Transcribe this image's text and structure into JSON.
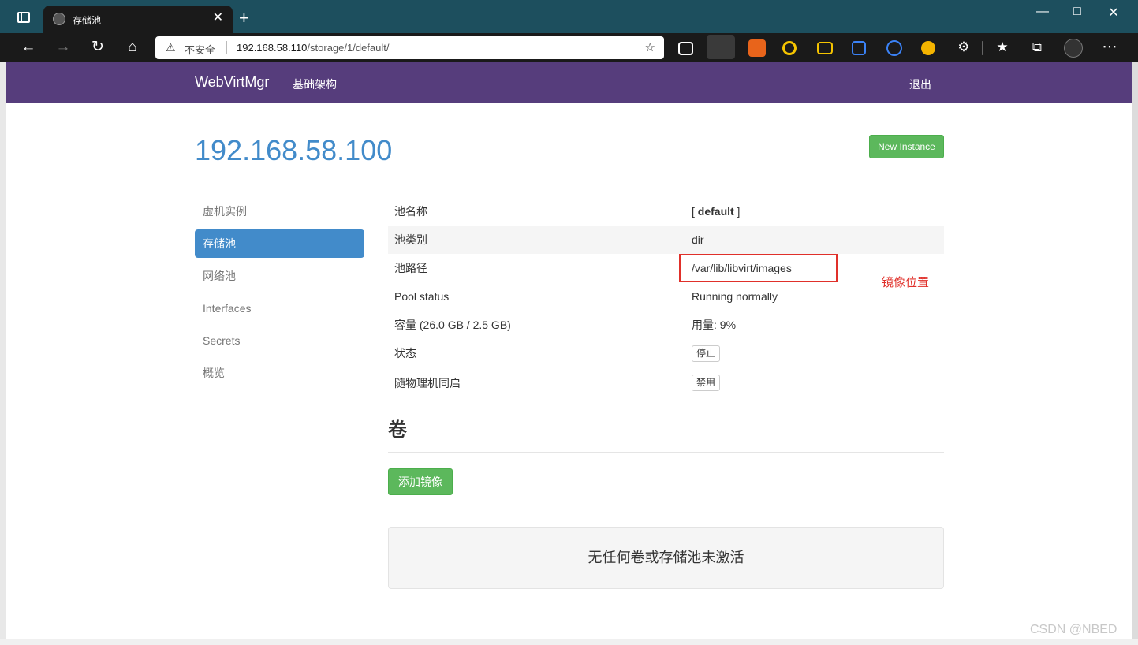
{
  "browser": {
    "tab_title": "存储池",
    "tab_close": "✕",
    "new_tab": "+",
    "insecure_label": "不安全",
    "url_host": "192.168.58.110",
    "url_path": "/storage/1/default/"
  },
  "navbar": {
    "brand": "WebVirtMgr",
    "infrastructure": "基础架构",
    "logout": "退出",
    "color": "#563d7c"
  },
  "page": {
    "title": "192.168.58.100",
    "new_instance": "New Instance"
  },
  "sidebar": {
    "items": [
      {
        "label": "虚机实例",
        "active": false
      },
      {
        "label": "存储池",
        "active": true
      },
      {
        "label": "网络池",
        "active": false
      },
      {
        "label": "Interfaces",
        "active": false
      },
      {
        "label": "Secrets",
        "active": false
      },
      {
        "label": "概览",
        "active": false
      }
    ]
  },
  "pool": {
    "rows": [
      {
        "label": "池名称",
        "value_prefix": "[ ",
        "value": "default",
        "value_suffix": " ]"
      },
      {
        "label": "池类别",
        "value": "dir"
      },
      {
        "label": "池路径",
        "value": "/var/lib/libvirt/images"
      },
      {
        "label": "Pool status",
        "value": "Running normally"
      },
      {
        "label": "容量 (26.0 GB / 2.5 GB)",
        "value": "用量: 9%"
      },
      {
        "label": "状态",
        "button": "停止"
      },
      {
        "label": "随物理机同启",
        "button": "禁用"
      }
    ]
  },
  "annotation": "镜像位置",
  "volumes": {
    "title": "卷",
    "add_button": "添加镜像",
    "empty_message": "无任何卷或存储池未激活"
  },
  "watermark": "CSDN @NBED"
}
